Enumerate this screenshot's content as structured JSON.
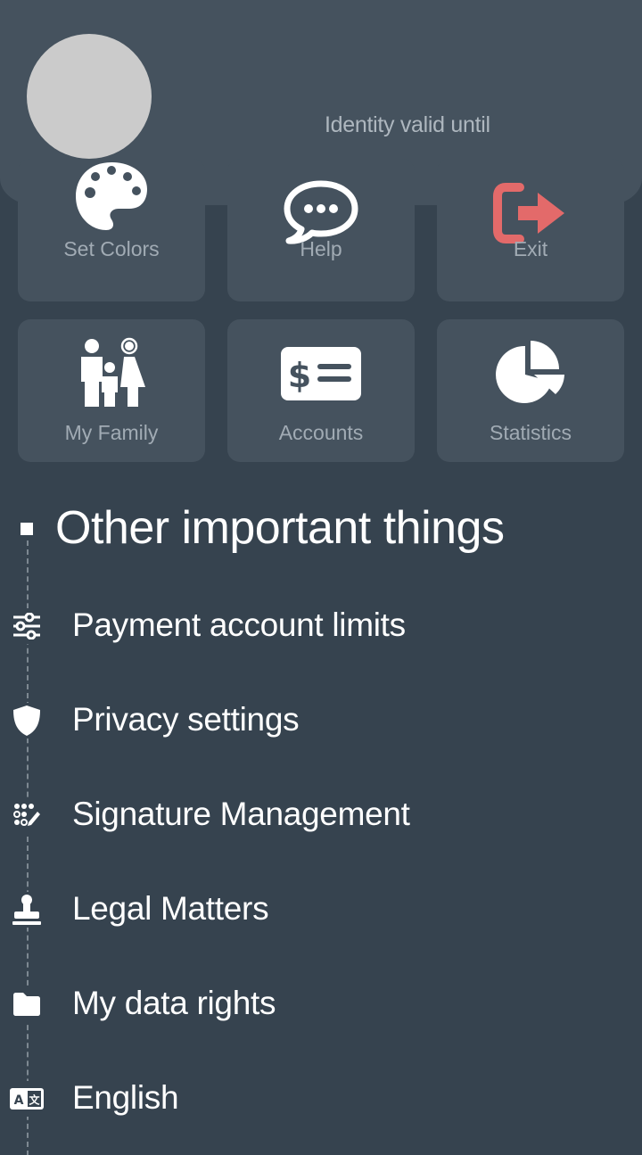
{
  "header": {
    "identity_text": "Identity valid until"
  },
  "tiles": [
    {
      "label": "Set Colors",
      "icon": "palette-icon"
    },
    {
      "label": "Help",
      "icon": "chat-bubble-icon"
    },
    {
      "label": "Exit",
      "icon": "logout-icon"
    },
    {
      "label": "My Family",
      "icon": "family-icon"
    },
    {
      "label": "Accounts",
      "icon": "money-bill-icon"
    },
    {
      "label": "Statistics",
      "icon": "pie-chart-icon"
    }
  ],
  "section": {
    "title": "Other important things"
  },
  "menu": [
    {
      "label": "Payment account limits",
      "icon": "sliders-icon"
    },
    {
      "label": "Privacy settings",
      "icon": "shield-icon"
    },
    {
      "label": "Signature Management",
      "icon": "signature-icon"
    },
    {
      "label": "Legal Matters",
      "icon": "stamp-icon"
    },
    {
      "label": "My data rights",
      "icon": "folder-icon"
    },
    {
      "label": "English",
      "icon": "language-icon"
    }
  ],
  "colors": {
    "background": "#36434f",
    "tile": "#45525e",
    "exit_accent": "#e36a6a",
    "label": "#a1abb4"
  }
}
